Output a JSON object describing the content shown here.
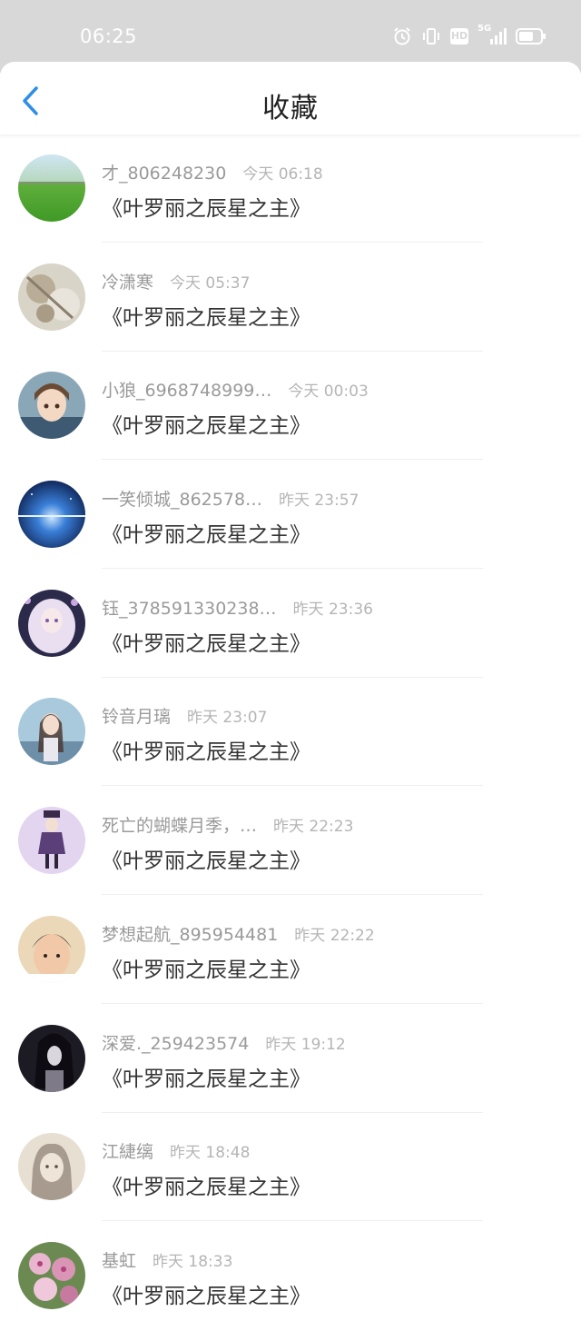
{
  "status": {
    "time": "06:25",
    "net_label": "5G",
    "hd_label": "HD"
  },
  "nav": {
    "title": "收藏"
  },
  "items": [
    {
      "name": "才_806248230",
      "time": "今天 06:18",
      "book": "《叶罗丽之辰星之主》"
    },
    {
      "name": "冷潇寒",
      "time": "今天 05:37",
      "book": "《叶罗丽之辰星之主》"
    },
    {
      "name": "小狼_6968748999…",
      "time": "今天 00:03",
      "book": "《叶罗丽之辰星之主》"
    },
    {
      "name": "一笑倾城_862578…",
      "time": "昨天 23:57",
      "book": "《叶罗丽之辰星之主》"
    },
    {
      "name": "钰_378591330238…",
      "time": "昨天 23:36",
      "book": "《叶罗丽之辰星之主》"
    },
    {
      "name": "铃音月璃",
      "time": "昨天 23:07",
      "book": "《叶罗丽之辰星之主》"
    },
    {
      "name": "死亡的蝴蝶月季，…",
      "time": "昨天 22:23",
      "book": "《叶罗丽之辰星之主》"
    },
    {
      "name": "梦想起航_895954481",
      "time": "昨天 22:22",
      "book": "《叶罗丽之辰星之主》"
    },
    {
      "name": "深爱._259423574",
      "time": "昨天 19:12",
      "book": "《叶罗丽之辰星之主》"
    },
    {
      "name": "江緁缡",
      "time": "昨天 18:48",
      "book": "《叶罗丽之辰星之主》"
    },
    {
      "name": "基虹",
      "time": "昨天 18:33",
      "book": "《叶罗丽之辰星之主》"
    }
  ],
  "colors": {
    "accent": "#2f8fe6",
    "status_bar": "#d8d8d8"
  }
}
